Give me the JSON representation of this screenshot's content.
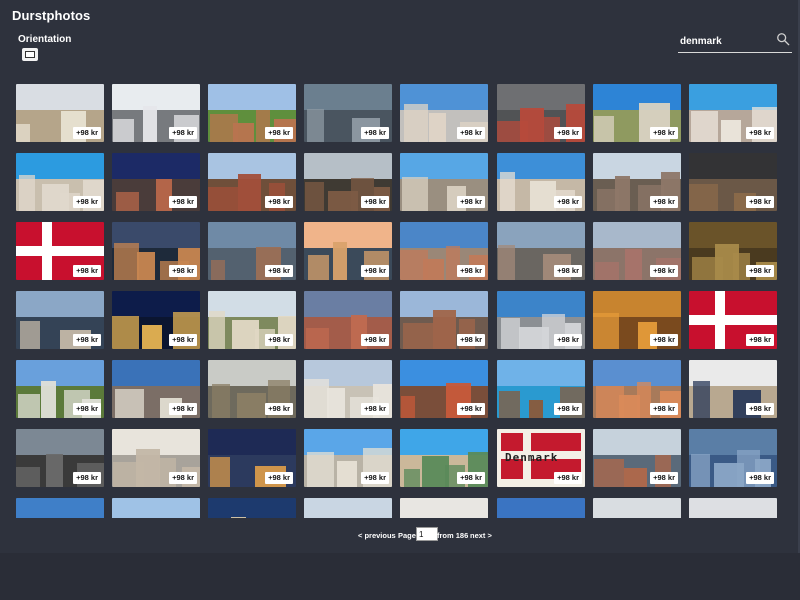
{
  "app": {
    "title": "Durstphotos"
  },
  "filters": {
    "orientation_label": "Orientation"
  },
  "search": {
    "value": "denmark",
    "icon": "search-icon"
  },
  "tiles": {
    "price_label": "+98 kr",
    "special_text": "Denmark"
  },
  "pager": {
    "previous_label": "< previous",
    "page_label": "Page",
    "current_page": "1",
    "from_label": "from 186",
    "next_label": "next >"
  }
}
